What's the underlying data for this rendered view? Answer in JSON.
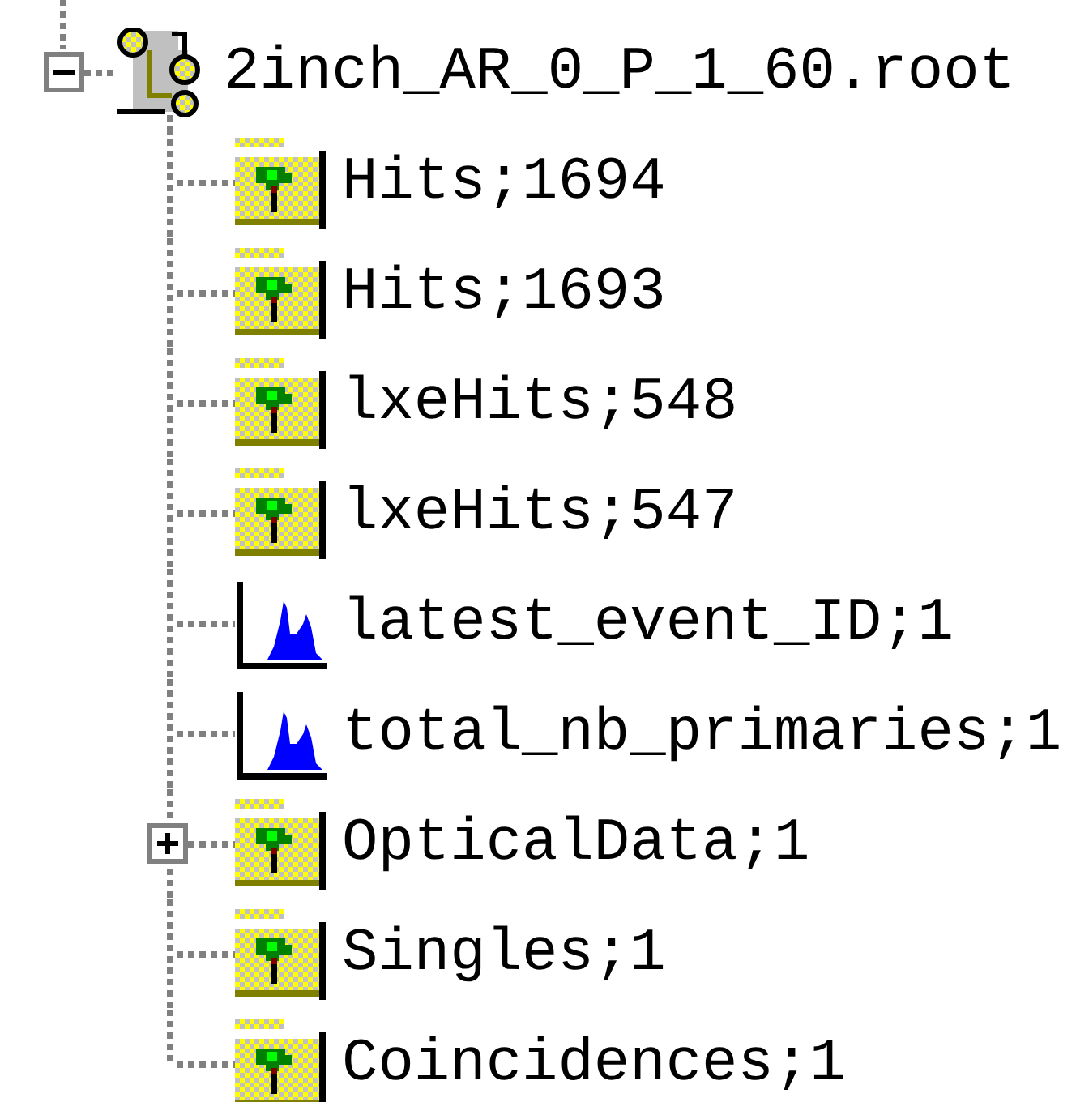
{
  "tree": {
    "root": {
      "label": "2inch_AR_0_P_1_60.root",
      "kind": "file",
      "expanded": true,
      "children": [
        {
          "label": "Hits;1694",
          "kind": "tree",
          "expandable": false
        },
        {
          "label": "Hits;1693",
          "kind": "tree",
          "expandable": false
        },
        {
          "label": "lxeHits;548",
          "kind": "tree",
          "expandable": false
        },
        {
          "label": "lxeHits;547",
          "kind": "tree",
          "expandable": false
        },
        {
          "label": "latest_event_ID;1",
          "kind": "histogram",
          "expandable": false
        },
        {
          "label": "total_nb_primaries;1",
          "kind": "histogram",
          "expandable": false
        },
        {
          "label": "OpticalData;1",
          "kind": "tree",
          "expandable": true
        },
        {
          "label": "Singles;1",
          "kind": "tree",
          "expandable": false
        },
        {
          "label": "Coincidences;1",
          "kind": "tree",
          "expandable": false
        }
      ]
    }
  }
}
